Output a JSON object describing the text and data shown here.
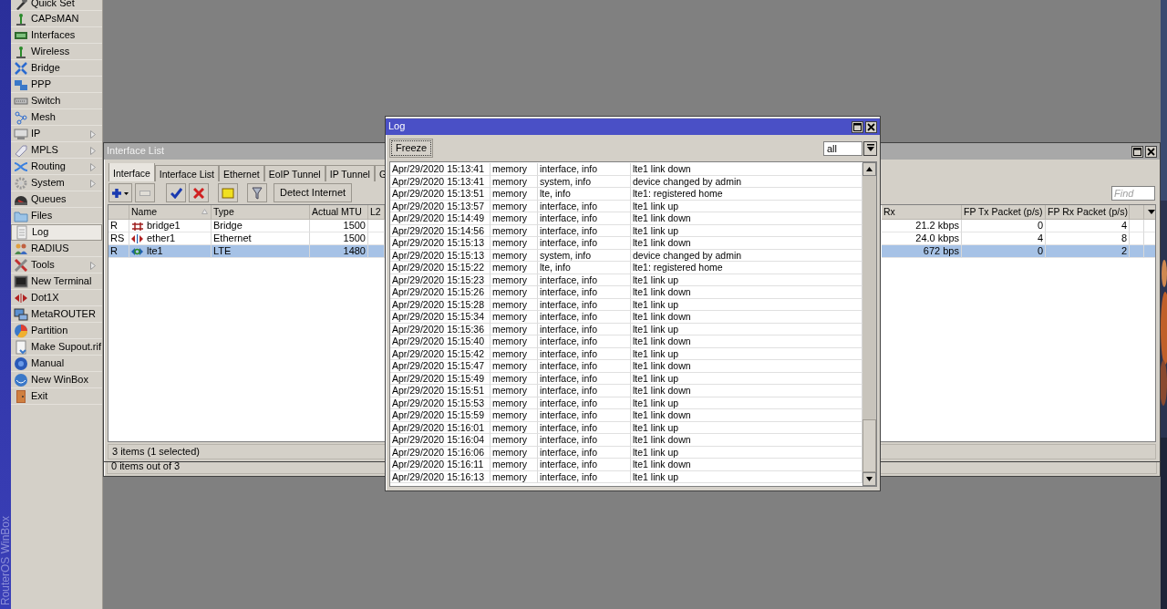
{
  "side_banner": "RouterOS WinBox",
  "sidebar": {
    "items": [
      {
        "label": "Quick Set",
        "selected": false,
        "submenu": false
      },
      {
        "label": "CAPsMAN",
        "selected": false,
        "submenu": false
      },
      {
        "label": "Interfaces",
        "selected": false,
        "submenu": false
      },
      {
        "label": "Wireless",
        "selected": false,
        "submenu": false
      },
      {
        "label": "Bridge",
        "selected": false,
        "submenu": false
      },
      {
        "label": "PPP",
        "selected": false,
        "submenu": false
      },
      {
        "label": "Switch",
        "selected": false,
        "submenu": false
      },
      {
        "label": "Mesh",
        "selected": false,
        "submenu": false
      },
      {
        "label": "IP",
        "selected": false,
        "submenu": true
      },
      {
        "label": "MPLS",
        "selected": false,
        "submenu": true
      },
      {
        "label": "Routing",
        "selected": false,
        "submenu": true
      },
      {
        "label": "System",
        "selected": false,
        "submenu": true
      },
      {
        "label": "Queues",
        "selected": false,
        "submenu": false
      },
      {
        "label": "Files",
        "selected": false,
        "submenu": false
      },
      {
        "label": "Log",
        "selected": true,
        "submenu": false
      },
      {
        "label": "RADIUS",
        "selected": false,
        "submenu": false
      },
      {
        "label": "Tools",
        "selected": false,
        "submenu": true
      },
      {
        "label": "New Terminal",
        "selected": false,
        "submenu": false
      },
      {
        "label": "Dot1X",
        "selected": false,
        "submenu": false
      },
      {
        "label": "MetaROUTER",
        "selected": false,
        "submenu": false
      },
      {
        "label": "Partition",
        "selected": false,
        "submenu": false
      },
      {
        "label": "Make Supout.rif",
        "selected": false,
        "submenu": false
      },
      {
        "label": "Manual",
        "selected": false,
        "submenu": false
      },
      {
        "label": "New WinBox",
        "selected": false,
        "submenu": false
      },
      {
        "label": "Exit",
        "selected": false,
        "submenu": false
      }
    ]
  },
  "interface_window": {
    "title": "Interface List",
    "tabs": [
      {
        "label": "Interface",
        "selected": true
      },
      {
        "label": "Interface List",
        "selected": false
      },
      {
        "label": "Ethernet",
        "selected": false
      },
      {
        "label": "EoIP Tunnel",
        "selected": false
      },
      {
        "label": "IP Tunnel",
        "selected": false
      },
      {
        "label": "G",
        "selected": false
      }
    ],
    "detect_button": "Detect Internet",
    "find": {
      "placeholder": "Find"
    },
    "columns_left": [
      "Name",
      "Type",
      "Actual MTU",
      "L2"
    ],
    "columns_right": [
      "Rx",
      "FP Tx Packet (p/s)",
      "FP Rx Packet (p/s)"
    ],
    "rows": [
      {
        "flags": "R",
        "name": "bridge1",
        "type": "Bridge",
        "actual_mtu": "1500",
        "rx": "21.2 kbps",
        "fp_tx": "0",
        "fp_rx": "4",
        "selected": false
      },
      {
        "flags": "RS",
        "name": "ether1",
        "type": "Ethernet",
        "actual_mtu": "1500",
        "rx": "24.0 kbps",
        "fp_tx": "4",
        "fp_rx": "8",
        "selected": false
      },
      {
        "flags": "R",
        "name": "lte1",
        "type": "LTE",
        "actual_mtu": "1480",
        "rx": "672 bps",
        "fp_tx": "0",
        "fp_rx": "2",
        "selected": true
      }
    ],
    "status": "3 items (1 selected)"
  },
  "back_window": {
    "status": "0 items out of 3"
  },
  "log_window": {
    "title": "Log",
    "freeze_button": "Freeze",
    "filter": "all",
    "rows": [
      {
        "time": "Apr/29/2020 15:13:41",
        "buffer": "memory",
        "topics": "interface, info",
        "message": "lte1 link down"
      },
      {
        "time": "Apr/29/2020 15:13:41",
        "buffer": "memory",
        "topics": "system, info",
        "message": "device changed by admin"
      },
      {
        "time": "Apr/29/2020 15:13:51",
        "buffer": "memory",
        "topics": "lte, info",
        "message": "lte1: registered home"
      },
      {
        "time": "Apr/29/2020 15:13:57",
        "buffer": "memory",
        "topics": "interface, info",
        "message": "lte1 link up"
      },
      {
        "time": "Apr/29/2020 15:14:49",
        "buffer": "memory",
        "topics": "interface, info",
        "message": "lte1 link down"
      },
      {
        "time": "Apr/29/2020 15:14:56",
        "buffer": "memory",
        "topics": "interface, info",
        "message": "lte1 link up"
      },
      {
        "time": "Apr/29/2020 15:15:13",
        "buffer": "memory",
        "topics": "interface, info",
        "message": "lte1 link down"
      },
      {
        "time": "Apr/29/2020 15:15:13",
        "buffer": "memory",
        "topics": "system, info",
        "message": "device changed by admin"
      },
      {
        "time": "Apr/29/2020 15:15:22",
        "buffer": "memory",
        "topics": "lte, info",
        "message": "lte1: registered home"
      },
      {
        "time": "Apr/29/2020 15:15:23",
        "buffer": "memory",
        "topics": "interface, info",
        "message": "lte1 link up"
      },
      {
        "time": "Apr/29/2020 15:15:26",
        "buffer": "memory",
        "topics": "interface, info",
        "message": "lte1 link down"
      },
      {
        "time": "Apr/29/2020 15:15:28",
        "buffer": "memory",
        "topics": "interface, info",
        "message": "lte1 link up"
      },
      {
        "time": "Apr/29/2020 15:15:34",
        "buffer": "memory",
        "topics": "interface, info",
        "message": "lte1 link down"
      },
      {
        "time": "Apr/29/2020 15:15:36",
        "buffer": "memory",
        "topics": "interface, info",
        "message": "lte1 link up"
      },
      {
        "time": "Apr/29/2020 15:15:40",
        "buffer": "memory",
        "topics": "interface, info",
        "message": "lte1 link down"
      },
      {
        "time": "Apr/29/2020 15:15:42",
        "buffer": "memory",
        "topics": "interface, info",
        "message": "lte1 link up"
      },
      {
        "time": "Apr/29/2020 15:15:47",
        "buffer": "memory",
        "topics": "interface, info",
        "message": "lte1 link down"
      },
      {
        "time": "Apr/29/2020 15:15:49",
        "buffer": "memory",
        "topics": "interface, info",
        "message": "lte1 link up"
      },
      {
        "time": "Apr/29/2020 15:15:51",
        "buffer": "memory",
        "topics": "interface, info",
        "message": "lte1 link down"
      },
      {
        "time": "Apr/29/2020 15:15:53",
        "buffer": "memory",
        "topics": "interface, info",
        "message": "lte1 link up"
      },
      {
        "time": "Apr/29/2020 15:15:59",
        "buffer": "memory",
        "topics": "interface, info",
        "message": "lte1 link down"
      },
      {
        "time": "Apr/29/2020 15:16:01",
        "buffer": "memory",
        "topics": "interface, info",
        "message": "lte1 link up"
      },
      {
        "time": "Apr/29/2020 15:16:04",
        "buffer": "memory",
        "topics": "interface, info",
        "message": "lte1 link down"
      },
      {
        "time": "Apr/29/2020 15:16:06",
        "buffer": "memory",
        "topics": "interface, info",
        "message": "lte1 link up"
      },
      {
        "time": "Apr/29/2020 15:16:11",
        "buffer": "memory",
        "topics": "interface, info",
        "message": "lte1 link down"
      },
      {
        "time": "Apr/29/2020 15:16:13",
        "buffer": "memory",
        "topics": "interface, info",
        "message": "lte1 link up"
      }
    ]
  }
}
